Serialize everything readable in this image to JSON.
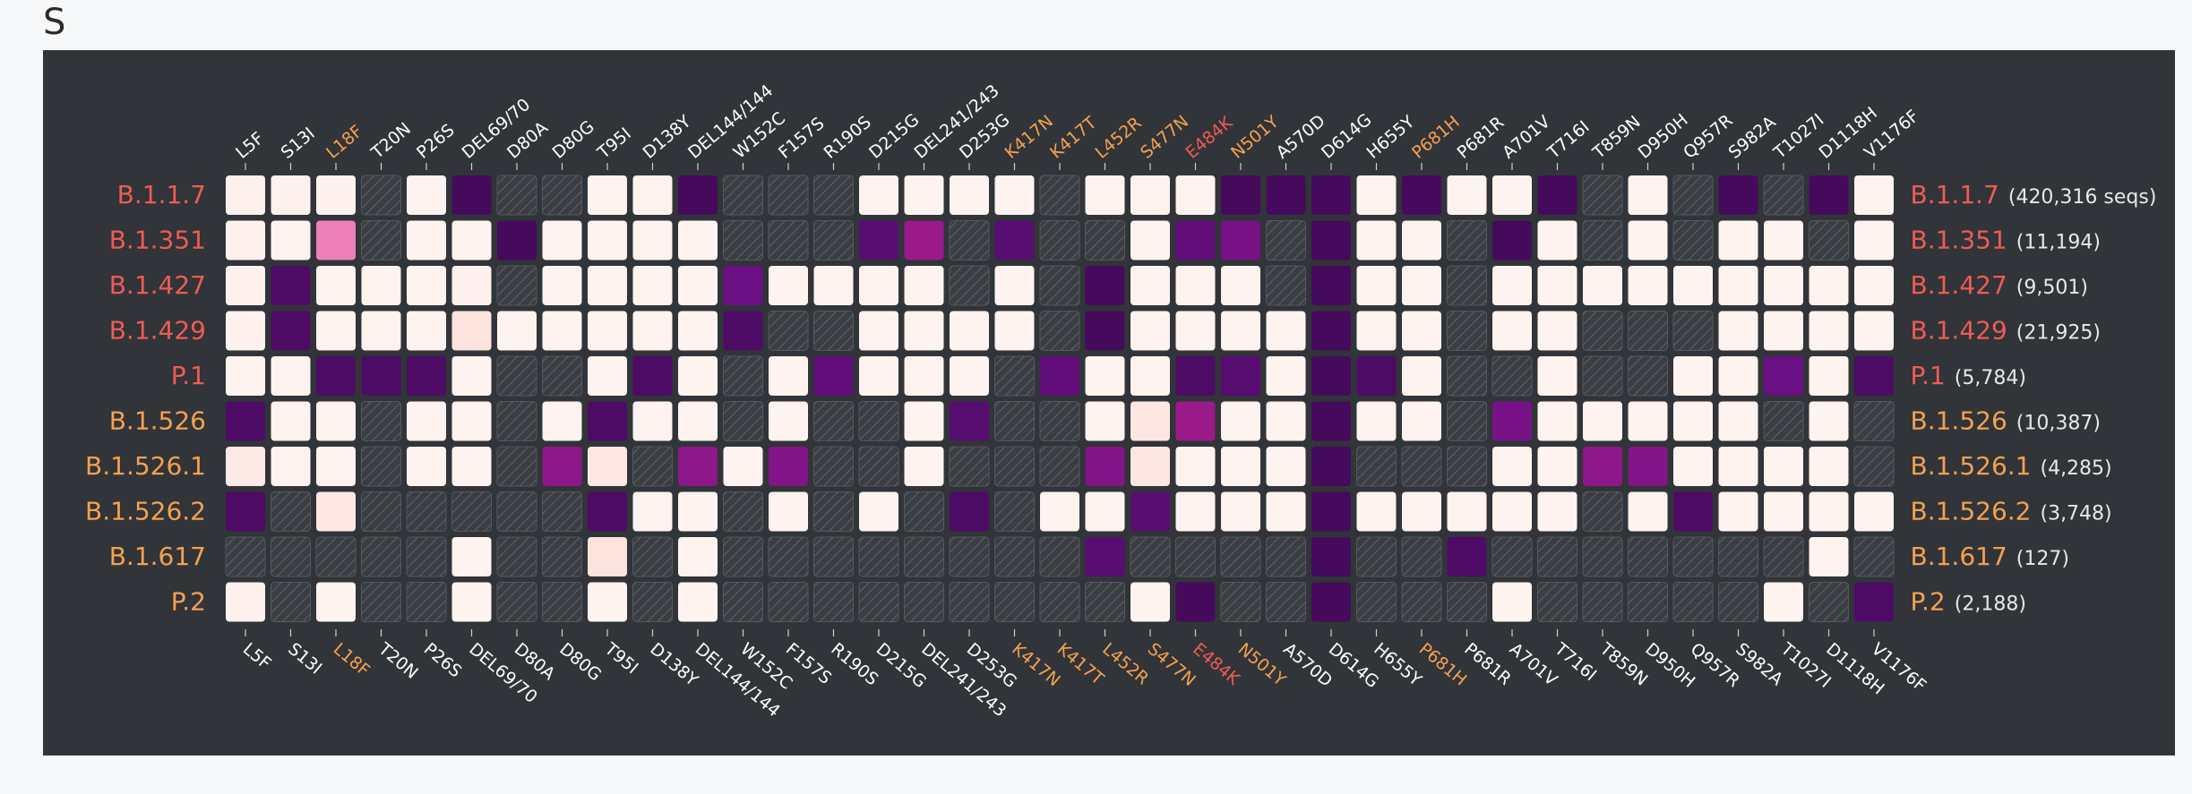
{
  "panel": {
    "title": "S"
  },
  "colors": {
    "background": "#313438",
    "present": "#fff5f2",
    "absent_fill": "#3a3d41",
    "absent_hatch": "#5d6066",
    "label_white": "#ffffff",
    "label_orange": "#f5a14f",
    "label_red": "#ef5b55",
    "count_text": "#e8e8e8"
  },
  "legend_scale": {
    "note": "cell values: -1 = not observed (hatched), 0..1 = frequency of mutation",
    "stops": [
      {
        "value": 0.0,
        "color": "#fff5f2"
      },
      {
        "value": 0.1,
        "color": "#fce3de"
      },
      {
        "value": 0.25,
        "color": "#f58fc0"
      },
      {
        "value": 0.4,
        "color": "#e162aa"
      },
      {
        "value": 0.6,
        "color": "#9a1a8a"
      },
      {
        "value": 0.8,
        "color": "#6a0f84"
      },
      {
        "value": 1.0,
        "color": "#450a5c"
      }
    ]
  },
  "chart_data": {
    "type": "heatmap",
    "mutations": [
      {
        "name": "L5F",
        "color": "white"
      },
      {
        "name": "S13I",
        "color": "white"
      },
      {
        "name": "L18F",
        "color": "orange"
      },
      {
        "name": "T20N",
        "color": "white"
      },
      {
        "name": "P26S",
        "color": "white"
      },
      {
        "name": "DEL69/70",
        "color": "white"
      },
      {
        "name": "D80A",
        "color": "white"
      },
      {
        "name": "D80G",
        "color": "white"
      },
      {
        "name": "T95I",
        "color": "white"
      },
      {
        "name": "D138Y",
        "color": "white"
      },
      {
        "name": "DEL144/144",
        "color": "white"
      },
      {
        "name": "W152C",
        "color": "white"
      },
      {
        "name": "F157S",
        "color": "white"
      },
      {
        "name": "R190S",
        "color": "white"
      },
      {
        "name": "D215G",
        "color": "white"
      },
      {
        "name": "DEL241/243",
        "color": "white"
      },
      {
        "name": "D253G",
        "color": "white"
      },
      {
        "name": "K417N",
        "color": "orange"
      },
      {
        "name": "K417T",
        "color": "orange"
      },
      {
        "name": "L452R",
        "color": "orange"
      },
      {
        "name": "S477N",
        "color": "orange"
      },
      {
        "name": "E484K",
        "color": "red"
      },
      {
        "name": "N501Y",
        "color": "orange"
      },
      {
        "name": "A570D",
        "color": "white"
      },
      {
        "name": "D614G",
        "color": "white"
      },
      {
        "name": "H655Y",
        "color": "white"
      },
      {
        "name": "P681H",
        "color": "orange"
      },
      {
        "name": "P681R",
        "color": "white"
      },
      {
        "name": "A701V",
        "color": "white"
      },
      {
        "name": "T716I",
        "color": "white"
      },
      {
        "name": "T859N",
        "color": "white"
      },
      {
        "name": "D950H",
        "color": "white"
      },
      {
        "name": "Q957R",
        "color": "white"
      },
      {
        "name": "S982A",
        "color": "white"
      },
      {
        "name": "T1027I",
        "color": "white"
      },
      {
        "name": "D1118H",
        "color": "white"
      },
      {
        "name": "V1176F",
        "color": "white"
      }
    ],
    "lineages": [
      {
        "name": "B.1.1.7",
        "count": "(420,316 seqs)",
        "color": "red"
      },
      {
        "name": "B.1.351",
        "count": "(11,194)",
        "color": "red"
      },
      {
        "name": "B.1.427",
        "count": "(9,501)",
        "color": "red"
      },
      {
        "name": "B.1.429",
        "count": "(21,925)",
        "color": "red"
      },
      {
        "name": "P.1",
        "count": "(5,784)",
        "color": "red"
      },
      {
        "name": "B.1.526",
        "count": "(10,387)",
        "color": "orange"
      },
      {
        "name": "B.1.526.1",
        "count": "(4,285)",
        "color": "orange"
      },
      {
        "name": "B.1.526.2",
        "count": "(3,748)",
        "color": "orange"
      },
      {
        "name": "B.1.617",
        "count": "(127)",
        "color": "orange"
      },
      {
        "name": "P.2",
        "count": "(2,188)",
        "color": "orange"
      }
    ],
    "values": [
      [
        0.03,
        0.02,
        0.02,
        -1,
        0.01,
        1,
        -1,
        -1,
        0.01,
        0.01,
        1,
        -1,
        -1,
        -1,
        0.01,
        0.01,
        0.01,
        0.01,
        -1,
        0.01,
        0.01,
        0.01,
        1,
        1,
        1,
        0.01,
        1,
        0.01,
        0.01,
        1,
        -1,
        0.01,
        -1,
        1,
        -1,
        1,
        0.01
      ],
      [
        0.02,
        0.01,
        0.3,
        -1,
        0.01,
        0.01,
        1,
        0.01,
        0.01,
        0.01,
        0.01,
        -1,
        -1,
        -1,
        0.9,
        0.6,
        -1,
        0.9,
        -1,
        -1,
        0.01,
        0.85,
        0.75,
        -1,
        1,
        0.01,
        0.01,
        -1,
        1,
        0.01,
        -1,
        0.01,
        -1,
        0.01,
        0.01,
        -1,
        0.01
      ],
      [
        0.02,
        0.95,
        0.01,
        0.01,
        0.01,
        0.02,
        -1,
        0.01,
        0.01,
        0.01,
        0.01,
        0.8,
        0.01,
        0.01,
        0.01,
        0.01,
        -1,
        0.01,
        -1,
        1,
        0.01,
        0.01,
        0.01,
        -1,
        1,
        0.01,
        0.01,
        -1,
        0.01,
        0.01,
        0.01,
        0.01,
        0.01,
        0.01,
        0.01,
        0.01,
        0.01
      ],
      [
        0.02,
        0.95,
        0.01,
        0.01,
        0.01,
        0.1,
        0.01,
        0.01,
        0.01,
        0.01,
        0.01,
        0.95,
        -1,
        -1,
        0.01,
        0.01,
        0.01,
        0.01,
        -1,
        1,
        0.01,
        0.01,
        0.01,
        0.01,
        1,
        0.01,
        0.01,
        -1,
        0.01,
        0.01,
        -1,
        -1,
        -1,
        0.01,
        0.01,
        0.01,
        0.01
      ],
      [
        0.01,
        0.01,
        0.95,
        0.95,
        0.95,
        0.01,
        -1,
        -1,
        0.01,
        0.95,
        0.01,
        -1,
        0.01,
        0.85,
        0.01,
        0.01,
        0.01,
        -1,
        0.85,
        0.01,
        0.01,
        0.95,
        0.9,
        0.01,
        1,
        0.95,
        0.01,
        -1,
        -1,
        0.01,
        -1,
        -1,
        0.01,
        0.01,
        0.8,
        0.01,
        0.95
      ],
      [
        0.95,
        0.01,
        0.01,
        -1,
        0.01,
        0.01,
        -1,
        0.01,
        0.95,
        0.01,
        0.01,
        -1,
        0.01,
        -1,
        -1,
        0.01,
        0.9,
        -1,
        -1,
        0.01,
        0.08,
        0.6,
        0.01,
        0.01,
        1,
        0.01,
        0.01,
        -1,
        0.75,
        0.01,
        0.01,
        0.01,
        0.01,
        0.01,
        -1,
        0.01,
        -1
      ],
      [
        0.06,
        0.01,
        0.01,
        -1,
        0.01,
        0.01,
        -1,
        0.65,
        0.07,
        -1,
        0.65,
        0.01,
        0.7,
        -1,
        -1,
        0.01,
        -1,
        -1,
        -1,
        0.7,
        0.08,
        0.01,
        0.01,
        0.01,
        1,
        -1,
        -1,
        -1,
        0.01,
        0.01,
        0.65,
        0.7,
        0.01,
        0.01,
        0.01,
        0.01,
        -1
      ],
      [
        0.95,
        -1,
        0.07,
        -1,
        -1,
        -1,
        -1,
        -1,
        0.95,
        0.01,
        0.01,
        -1,
        0.01,
        -1,
        0.01,
        -1,
        0.95,
        -1,
        0.01,
        0.01,
        0.9,
        0.01,
        0.01,
        0.01,
        1,
        0.01,
        0.01,
        0.01,
        0.01,
        0.01,
        -1,
        0.01,
        0.95,
        0.01,
        0.01,
        0.01,
        0.01
      ],
      [
        -1,
        -1,
        -1,
        -1,
        -1,
        0.01,
        -1,
        -1,
        0.1,
        -1,
        0.01,
        -1,
        -1,
        -1,
        -1,
        -1,
        -1,
        -1,
        -1,
        0.9,
        -1,
        -1,
        -1,
        -1,
        1,
        -1,
        -1,
        0.95,
        -1,
        -1,
        -1,
        -1,
        -1,
        -1,
        -1,
        0.01,
        -1
      ],
      [
        0.02,
        -1,
        0.01,
        -1,
        -1,
        0.01,
        -1,
        -1,
        0.01,
        -1,
        0.01,
        -1,
        -1,
        -1,
        -1,
        -1,
        -1,
        -1,
        -1,
        -1,
        0.01,
        1,
        -1,
        -1,
        1,
        -1,
        -1,
        -1,
        0.01,
        -1,
        -1,
        -1,
        -1,
        -1,
        0.01,
        -1,
        0.95
      ]
    ]
  }
}
